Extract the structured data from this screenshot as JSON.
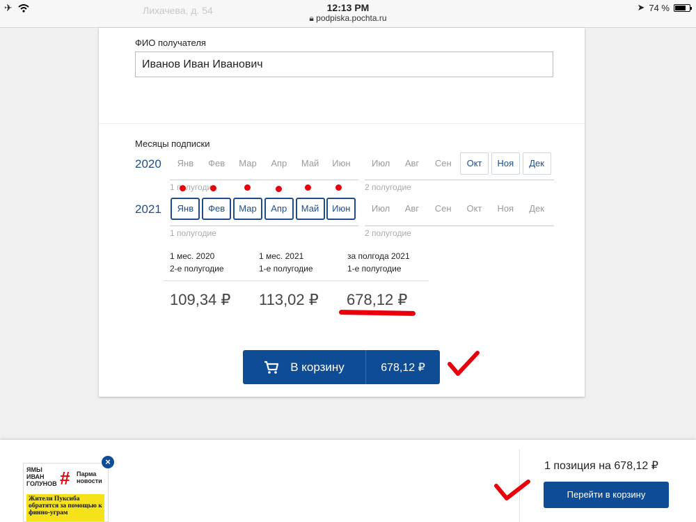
{
  "status_bar": {
    "time": "12:13 PM",
    "url": "podpiska.pochta.ru",
    "battery": "74 %",
    "battery_level": 0.74
  },
  "background_address": "Лихачева, д. 54",
  "form": {
    "recipient_label": "ФИО получателя",
    "recipient_value": "Иванов Иван Иванович",
    "months_label": "Месяцы подписки"
  },
  "years": [
    {
      "year": "2020",
      "months": [
        "Янв",
        "Фев",
        "Мар",
        "Апр",
        "Май",
        "Июн",
        "Июл",
        "Авг",
        "Сен",
        "Окт",
        "Ноя",
        "Дек"
      ],
      "half1": "1 полугодие",
      "half2": "2 полугодие"
    },
    {
      "year": "2021",
      "months": [
        "Янв",
        "Фев",
        "Мар",
        "Апр",
        "Май",
        "Июн",
        "Июл",
        "Авг",
        "Сен",
        "Окт",
        "Ноя",
        "Дек"
      ],
      "half1": "1 полугодие",
      "half2": "2 полугодие"
    }
  ],
  "prices": [
    {
      "line1": "1 мес. 2020",
      "line2": "2-е полугодие",
      "amount": "109,34 ₽"
    },
    {
      "line1": "1 мес. 2021",
      "line2": "1-е полугодие",
      "amount": "113,02 ₽"
    },
    {
      "line1": "за полгода 2021",
      "line2": "1-е полугодие",
      "amount": "678,12 ₽"
    }
  ],
  "cart_button": {
    "label": "В корзину",
    "price": "678,12 ₽"
  },
  "bottom": {
    "summary": "1 позиция на 678,12 ₽",
    "goto_label": "Перейти в корзину",
    "close_symbol": "×",
    "thumbnail": {
      "top_text": "ЯМЫ ИВАН ГОЛУНОВ",
      "hash": "#",
      "brand": "Парма новости",
      "headline": "Жители Пуксиба обратятся за помощью к финно-уграм"
    }
  },
  "colors": {
    "primary": "#0f4c96",
    "annotation": "#e8000a"
  }
}
